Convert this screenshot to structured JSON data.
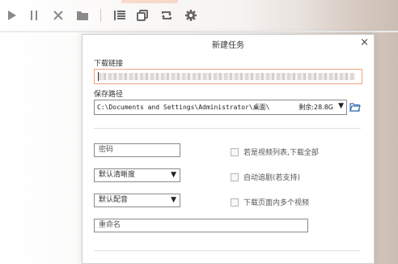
{
  "toolbar": {
    "icons": [
      "play-icon",
      "pause-icon",
      "delete-icon",
      "folder-icon",
      "list-icon",
      "copy-icon",
      "refresh-icon",
      "settings-icon"
    ]
  },
  "dialog": {
    "title": "新建任务",
    "close": "×",
    "url_label": "下载链接",
    "url_value": "",
    "path_label": "保存路径",
    "path_value": "C:\\Documents and Settings\\Administrator\\桌面\\",
    "free_space": "剩余:28.8G",
    "password_placeholder": "密码",
    "quality_value": "默认清晰度",
    "audio_value": "默认配音",
    "rename_placeholder": "重命名",
    "options": [
      {
        "label": "若是视频列表,下载全部",
        "checked": false
      },
      {
        "label": "自动追剧(若支持)",
        "checked": false
      },
      {
        "label": "下载页面内多个视频",
        "checked": false
      }
    ]
  },
  "colors": {
    "accent_border": "#f0a57e",
    "toolbar_icon": "#666666"
  }
}
